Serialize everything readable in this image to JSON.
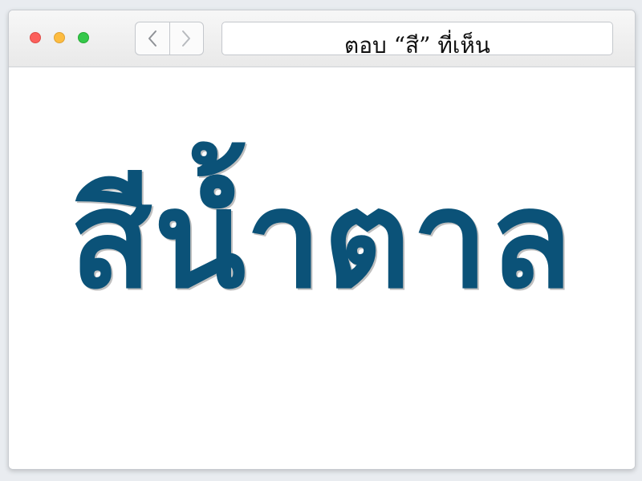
{
  "window": {
    "traffic_lights": [
      "close",
      "minimize",
      "maximize"
    ]
  },
  "toolbar": {
    "back_icon": "chevron-left-icon",
    "forward_icon": "chevron-right-icon"
  },
  "address_bar": {
    "text": "ตอบ “สี” ที่เห็น"
  },
  "main": {
    "word": "สีน้ำตาล",
    "word_color": "#0b5278"
  }
}
